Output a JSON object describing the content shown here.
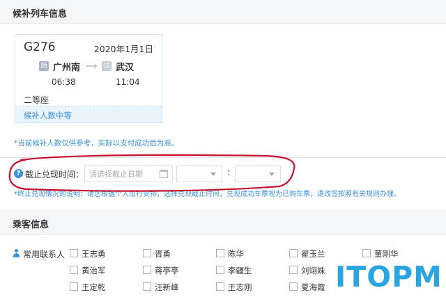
{
  "sections": {
    "waitlist_title": "候补列车信息",
    "passenger_title": "乘客信息"
  },
  "ticket": {
    "train_no": "G276",
    "date": "2020年1月1日",
    "start_badge": "始",
    "pass_badge": "过",
    "from_station": "广州南",
    "to_station": "武汉",
    "depart_time": "06:38",
    "arrive_time": "11:04",
    "seat": "二等座",
    "waitlist_status": "候补人数中等"
  },
  "notes": {
    "reference": "*当前候补人数仅供参考，实际以支付成功后为准。",
    "deadline_explain": "*终止兑现情况的说明：请您根据个人出行安排，选择兑现截止时间，兑现成功车票视为已购车票，退改签按照有关规则办理。"
  },
  "deadline": {
    "help_icon": "?",
    "label": "截止兑现时间：",
    "date_placeholder": "请选择截止日期",
    "colon": ":"
  },
  "passengers": {
    "contacts_label": "常用联系人",
    "names": [
      "王志勇",
      "胥勇",
      "陈华",
      "翟玉兰",
      "董刚华",
      "黄治军",
      "蒋亭亭",
      "李疆生",
      "刘翊姝",
      "王定乾",
      "汪新峰",
      "王志刚",
      "夏海霞"
    ]
  },
  "colors": {
    "accent": "#3b8fd9",
    "annotation": "#c8102e",
    "watermark": "#2aa5e0"
  },
  "watermark": {
    "text": "ITOPM"
  }
}
